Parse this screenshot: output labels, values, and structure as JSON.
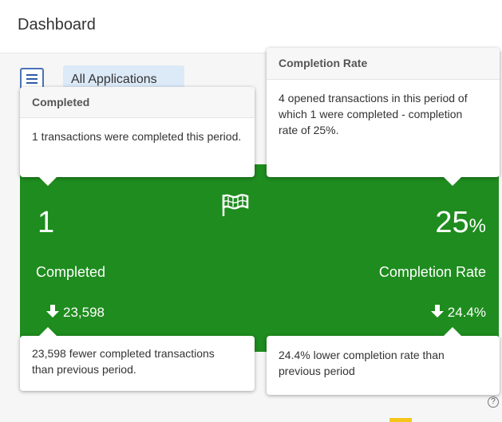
{
  "header": {
    "title": "Dashboard"
  },
  "toolbar": {
    "app_tab_label": "All Applications"
  },
  "card": {
    "completed_value": "1",
    "completed_label": "Completed",
    "completed_delta": "23,598",
    "rate_value": "25",
    "rate_unit": "%",
    "rate_label": "Completion Rate",
    "rate_delta": "24.4%",
    "color": "#1e8c1e",
    "icons": {
      "center": "flag-icon",
      "delta": "arrow-down-icon"
    }
  },
  "tooltips": {
    "completed": {
      "title": "Completed",
      "body": "1 transactions were completed this period."
    },
    "rate": {
      "title": "Completion Rate",
      "body": "4 opened transactions in this period of which 1 were completed - completion rate of 25%."
    },
    "completed_delta": {
      "body": "23,598 fewer completed transactions than previous period."
    },
    "rate_delta": {
      "body": "24.4% lower completion rate than previous period"
    }
  },
  "help": {
    "glyph": "?"
  }
}
